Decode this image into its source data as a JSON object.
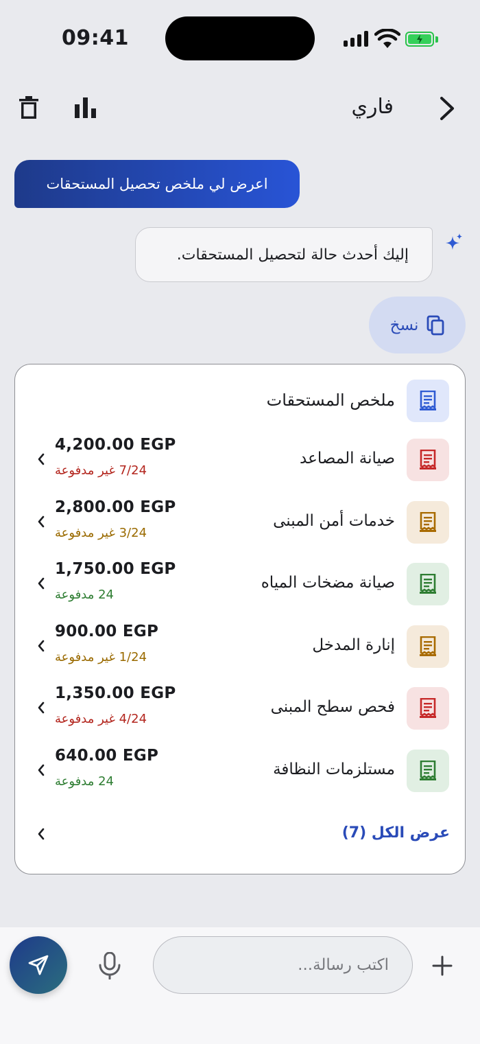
{
  "status": {
    "time": "09:41"
  },
  "nav": {
    "title": "فاري"
  },
  "chat": {
    "user_message": "اعرض لي ملخص تحصيل المستحقات",
    "bot_message": "إليك أحدث حالة لتحصيل المستحقات.",
    "copy_label": "نسخ"
  },
  "card": {
    "title": "ملخص المستحقات",
    "rows": [
      {
        "name": "صيانة المصاعد",
        "amount": "4,200.00 EGP",
        "status": "7/24 غير مدفوعة",
        "status_color": "#b3261e",
        "icon_bg": "#f7e2e2",
        "icon_color": "#c62828"
      },
      {
        "name": "خدمات أمن المبنى",
        "amount": "2,800.00 EGP",
        "status": "3/24 غير مدفوعة",
        "status_color": "#9a6a00",
        "icon_bg": "#f5eadb",
        "icon_color": "#a86a00"
      },
      {
        "name": "صيانة مضخات المياه",
        "amount": "1,750.00 EGP",
        "status": "24 مدفوعة",
        "status_color": "#2e7d32",
        "icon_bg": "#e1efe3",
        "icon_color": "#2e7d32"
      },
      {
        "name": "إنارة المدخل",
        "amount": "900.00 EGP",
        "status": "1/24 غير مدفوعة",
        "status_color": "#9a6a00",
        "icon_bg": "#f5eadb",
        "icon_color": "#a86a00"
      },
      {
        "name": "فحص سطح المبنى",
        "amount": "1,350.00 EGP",
        "status": "4/24 غير مدفوعة",
        "status_color": "#b3261e",
        "icon_bg": "#f7e2e2",
        "icon_color": "#c62828"
      },
      {
        "name": "مستلزمات النظافة",
        "amount": "640.00 EGP",
        "status": "24 مدفوعة",
        "status_color": "#2e7d32",
        "icon_bg": "#e1efe3",
        "icon_color": "#2e7d32"
      }
    ],
    "view_all": "عرض الكل (7)"
  },
  "composer": {
    "placeholder": "اكتب رسالة..."
  },
  "colors": {
    "accent": "#2a4bb8",
    "header_icon": "#2f5bd3"
  }
}
